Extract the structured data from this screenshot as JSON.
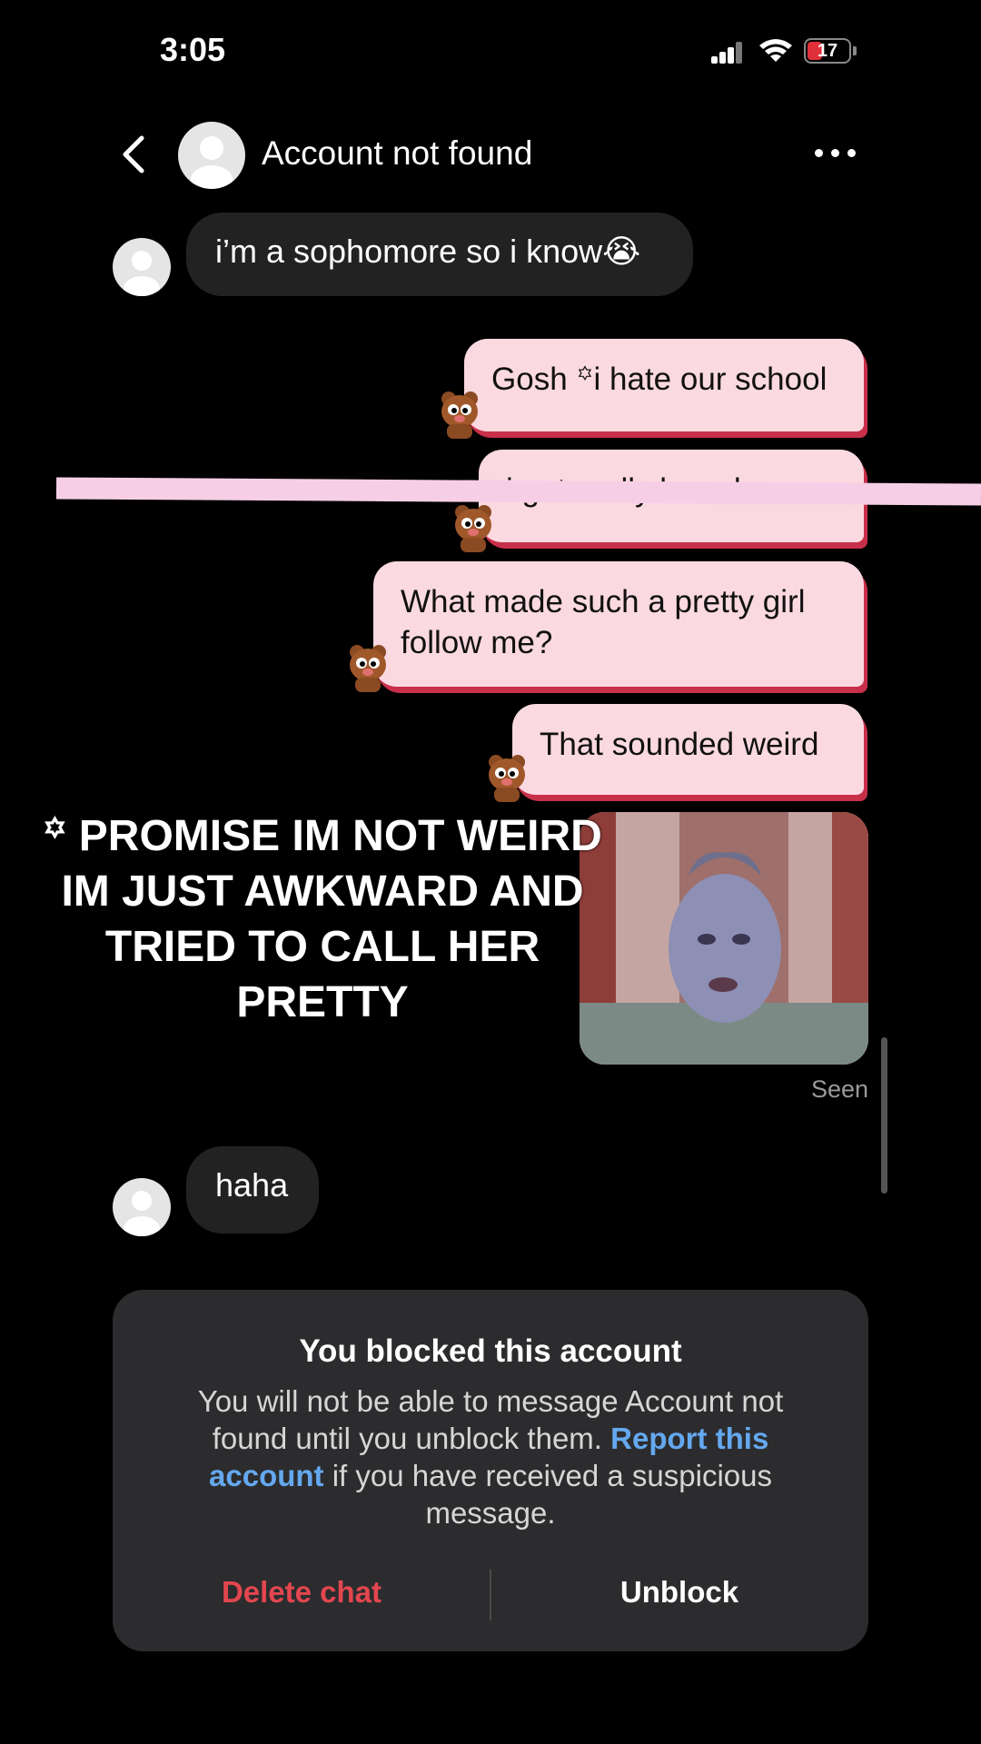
{
  "status_bar": {
    "time": "3:05",
    "battery": "17"
  },
  "header": {
    "title": "Account not found"
  },
  "messages": [
    {
      "side": "in",
      "text": "i’m a sophomore so i know😭"
    },
    {
      "side": "out",
      "text": "Gosh ꙳i hate our school"
    },
    {
      "side": "out",
      "text": "i got really bored..."
    },
    {
      "side": "out",
      "text": "What made such a pretty girl follow me?"
    },
    {
      "side": "out",
      "text": "That sounded weird"
    },
    {
      "side": "in",
      "text": "haha"
    }
  ],
  "overlay_caption": "꙳ PROMISE IM NOT WEIRD IM JUST AWKWARD AND TRIED TO CALL HER PRETTY",
  "seen_label": "Seen",
  "blocked_card": {
    "title": "You blocked this account",
    "body_part1": "You will not be able to message Account not found until you unblock them. ",
    "link_text": "Report this account",
    "body_part2": " if you have received a suspicious message.",
    "delete_label": "Delete chat",
    "unblock_label": "Unblock"
  },
  "colors": {
    "outgoing_bubble": "#fbd9e1",
    "outgoing_shadow": "#c8304a",
    "link": "#64a8ef",
    "danger": "#e3464f"
  }
}
